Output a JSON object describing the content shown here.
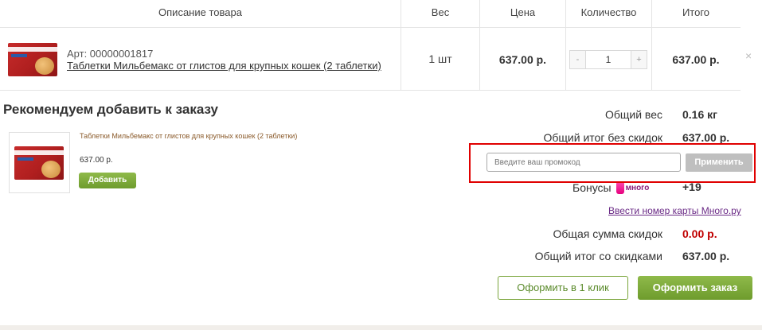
{
  "table": {
    "headers": [
      "Описание товара",
      "Вес",
      "Цена",
      "Количество",
      "Итого"
    ],
    "item": {
      "article": "Арт: 00000001817",
      "name": "Таблетки Мильбемакс от глистов для крупных кошек (2 таблетки)",
      "weight": "1 шт",
      "price": "637.00 р.",
      "qty_minus": "-",
      "qty_value": "1",
      "qty_plus": "+",
      "total": "637.00 р.",
      "remove": "×"
    }
  },
  "recommend": {
    "title": "Рекомендуем добавить к заказу",
    "product_name": "Таблетки Мильбемакс от глистов для крупных кошек (2 таблетки)",
    "price": "637.00 р.",
    "add_label": "Добавить"
  },
  "summary": {
    "weight_label": "Общий вес",
    "weight_value": "0.16 кг",
    "subtotal_label": "Общий итог без скидок",
    "subtotal_value": "637.00 р.",
    "bonus_label": "Бонусы",
    "bonus_brand": "много",
    "bonus_value": "+19",
    "card_link": "Ввести номер карты Много.ру",
    "discount_label": "Общая сумма скидок",
    "discount_value": "0.00 р.",
    "total_label": "Общий итог со скидками",
    "total_value": "637.00 р."
  },
  "promo": {
    "placeholder": "Введите ваш промокод",
    "apply_label": "Применить"
  },
  "actions": {
    "one_click": "Оформить в 1 клик",
    "checkout": "Оформить заказ"
  },
  "colors": {
    "accent_green": "#7aa53b",
    "highlight_red": "#e00000",
    "discount_red": "#c00000",
    "link_purple": "#6a2a86"
  }
}
